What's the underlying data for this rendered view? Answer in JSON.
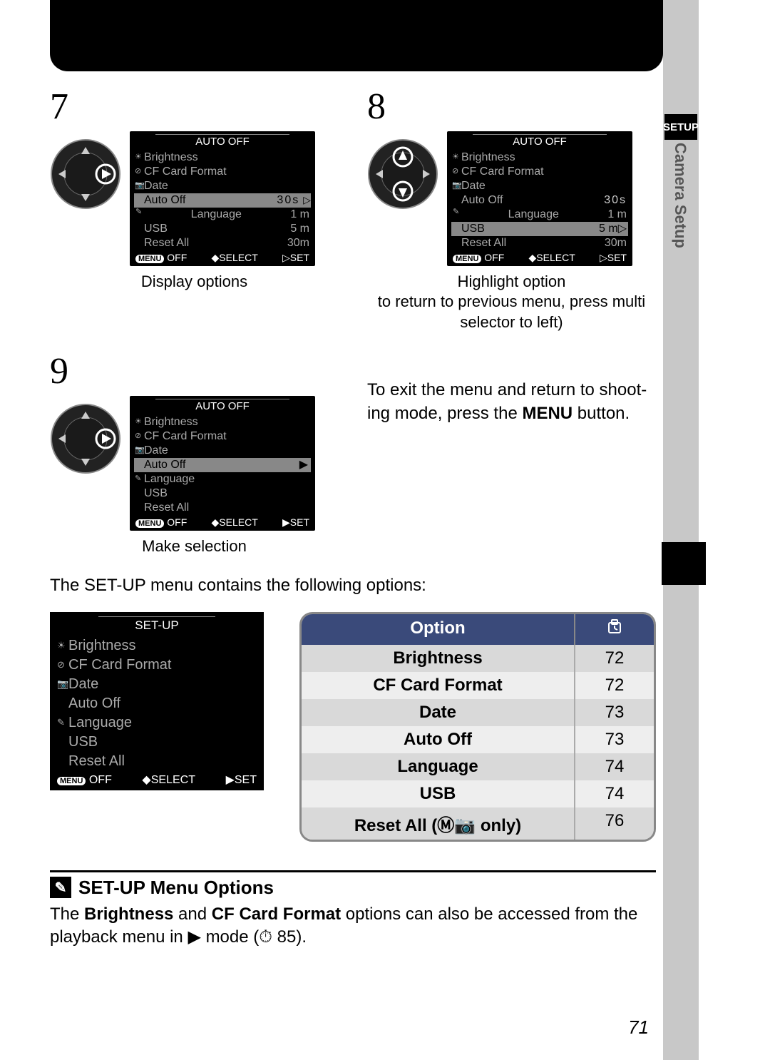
{
  "side_tab": "SETUP",
  "side_label": "Camera Setup",
  "steps": {
    "s7": {
      "num": "7",
      "lcd": {
        "title": "AUTO OFF",
        "items": [
          "Brightness",
          "CF Card Format",
          "Date",
          "Auto Off",
          "Language",
          "USB",
          "Reset All"
        ],
        "sel": "Auto Off",
        "sel_val": "30s",
        "subvals": [
          "1 m",
          "5 m",
          "30m"
        ],
        "foot_off": "OFF",
        "foot_menu": "MENU",
        "foot_sel": "SELECT",
        "foot_set": "SET"
      },
      "caption": "Display options"
    },
    "s8": {
      "num": "8",
      "lcd": {
        "title": "AUTO OFF",
        "items": [
          "Brightness",
          "CF Card Format",
          "Date",
          "Auto Off",
          "Language",
          "USB",
          "Reset All"
        ],
        "grayvals": [
          "30s",
          "1 m",
          "5 m",
          "30m"
        ],
        "sel_sub": "5 m",
        "foot_off": "OFF",
        "foot_menu": "MENU",
        "foot_sel": "SELECT",
        "foot_set": "SET"
      },
      "caption1": "Highlight option",
      "caption2": "to return to previous menu, press multi selector to left)"
    },
    "s9": {
      "num": "9",
      "lcd": {
        "title": "AUTO OFF",
        "items": [
          "Brightness",
          "CF Card Format",
          "Date",
          "Auto Off",
          "Language",
          "USB",
          "Reset All"
        ],
        "sel": "Auto Off",
        "foot_off": "OFF",
        "foot_menu": "MENU",
        "foot_sel": "SELECT",
        "foot_set": "SET"
      },
      "caption": "Make selection"
    }
  },
  "exit_text_a": "To exit the menu and return to shoot-",
  "exit_text_b": "ing mode, press the ",
  "exit_text_c": "MENU",
  "exit_text_d": " button.",
  "intro": "The SET-UP menu contains the following options:",
  "setup_lcd": {
    "title": "SET-UP",
    "items": [
      "Brightness",
      "CF Card Format",
      "Date",
      "Auto Off",
      "Language",
      "USB",
      "Reset All"
    ],
    "foot_off": "OFF",
    "foot_menu": "MENU",
    "foot_sel": "SELECT",
    "foot_set": "SET"
  },
  "table": {
    "head_option": "Option",
    "head_page_icon": "⏱",
    "rows": [
      {
        "opt": "Brightness",
        "pg": "72"
      },
      {
        "opt": "CF Card Format",
        "pg": "72"
      },
      {
        "opt": "Date",
        "pg": "73"
      },
      {
        "opt": "Auto Off",
        "pg": "73"
      },
      {
        "opt": "Language",
        "pg": "74"
      },
      {
        "opt": "USB",
        "pg": "74"
      },
      {
        "opt": "Reset All (Ⓜ📷 only)",
        "pg": "76"
      }
    ]
  },
  "note": {
    "title": "SET-UP Menu Options",
    "body_a": "The ",
    "body_b": "Brightness",
    "body_c": " and ",
    "body_d": "CF Card Format",
    "body_e": " options can also be accessed from the playback menu in ▶ mode (⏱ 85)."
  },
  "page_number": "71"
}
